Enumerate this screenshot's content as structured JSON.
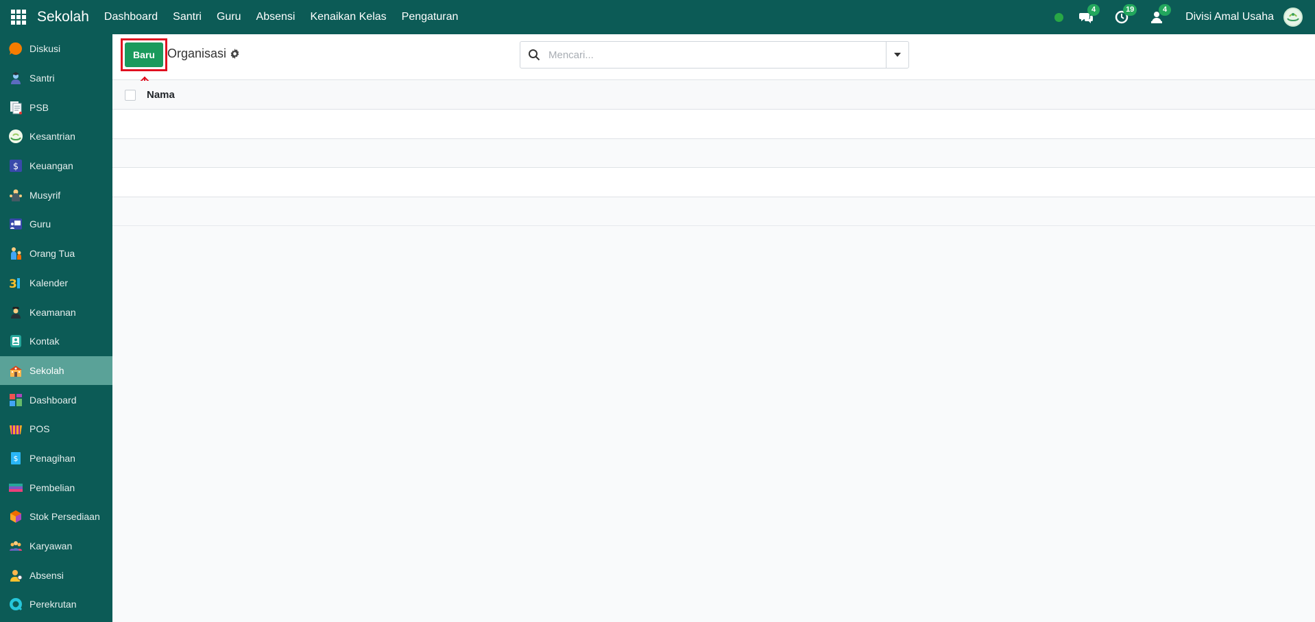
{
  "navbar": {
    "brand": "Sekolah",
    "menu": [
      "Dashboard",
      "Santri",
      "Guru",
      "Absensi",
      "Kenaikan Kelas",
      "Pengaturan"
    ],
    "messages_count": "4",
    "activities_count": "19",
    "notifications_count": "4",
    "user_name": "Divisi Amal Usaha"
  },
  "sidebar": {
    "items": [
      {
        "label": "Diskusi",
        "icon": "discuss-icon"
      },
      {
        "label": "Santri",
        "icon": "student-icon"
      },
      {
        "label": "PSB",
        "icon": "documents-icon"
      },
      {
        "label": "Kesantrian",
        "icon": "kesantrian-logo-icon"
      },
      {
        "label": "Keuangan",
        "icon": "finance-icon"
      },
      {
        "label": "Musyrif",
        "icon": "mentor-icon"
      },
      {
        "label": "Guru",
        "icon": "teacher-icon"
      },
      {
        "label": "Orang Tua",
        "icon": "parent-icon"
      },
      {
        "label": "Kalender",
        "icon": "calendar-icon"
      },
      {
        "label": "Keamanan",
        "icon": "security-guard-icon"
      },
      {
        "label": "Kontak",
        "icon": "contact-icon"
      },
      {
        "label": "Sekolah",
        "icon": "school-icon"
      },
      {
        "label": "Dashboard",
        "icon": "dashboard-icon"
      },
      {
        "label": "POS",
        "icon": "pos-store-icon"
      },
      {
        "label": "Penagihan",
        "icon": "invoice-icon"
      },
      {
        "label": "Pembelian",
        "icon": "purchase-icon"
      },
      {
        "label": "Stok Persediaan",
        "icon": "inventory-icon"
      },
      {
        "label": "Karyawan",
        "icon": "employees-icon"
      },
      {
        "label": "Absensi",
        "icon": "attendance-icon"
      },
      {
        "label": "Perekrutan",
        "icon": "recruitment-icon"
      }
    ],
    "active_index": 11
  },
  "control_panel": {
    "new_button": "Baru",
    "breadcrumb": "Organisasi",
    "search_placeholder": "Mencari..."
  },
  "list": {
    "columns": [
      "Nama"
    ],
    "rows": [],
    "empty_rows": 4
  },
  "colors": {
    "navbar_bg": "#0c5b56",
    "sidebar_active": "#5aa298",
    "primary_button": "#1a9a5d",
    "annotation_red": "#e01020"
  }
}
